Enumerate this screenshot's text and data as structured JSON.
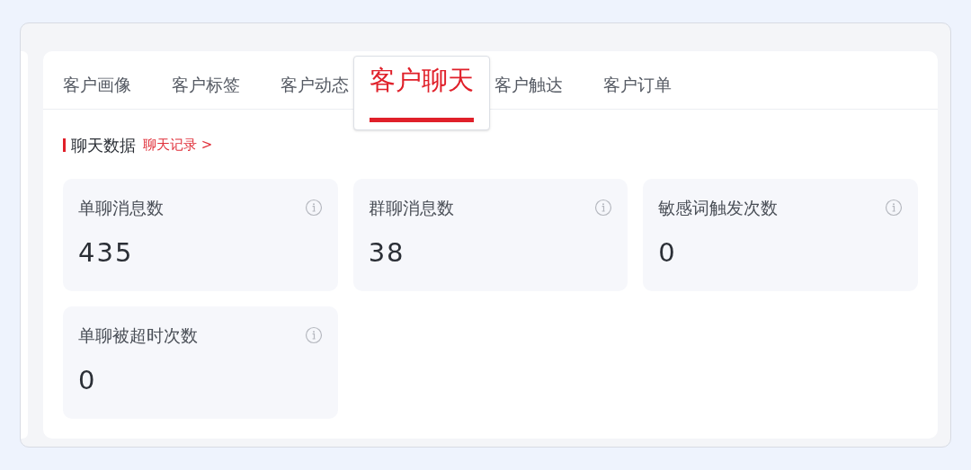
{
  "tabs": [
    {
      "label": "客户画像",
      "selected": false
    },
    {
      "label": "客户标签",
      "selected": false
    },
    {
      "label": "客户动态",
      "selected": false
    },
    {
      "label": "客户聊天",
      "selected": true
    },
    {
      "label": "客户触达",
      "selected": false
    },
    {
      "label": "客户订单",
      "selected": false
    }
  ],
  "section": {
    "title": "聊天数据",
    "link": "聊天记录 >"
  },
  "stats": [
    {
      "label": "单聊消息数",
      "value": "435"
    },
    {
      "label": "群聊消息数",
      "value": "38"
    },
    {
      "label": "敏感词触发次数",
      "value": "0"
    },
    {
      "label": "单聊被超时次数",
      "value": "0"
    }
  ]
}
